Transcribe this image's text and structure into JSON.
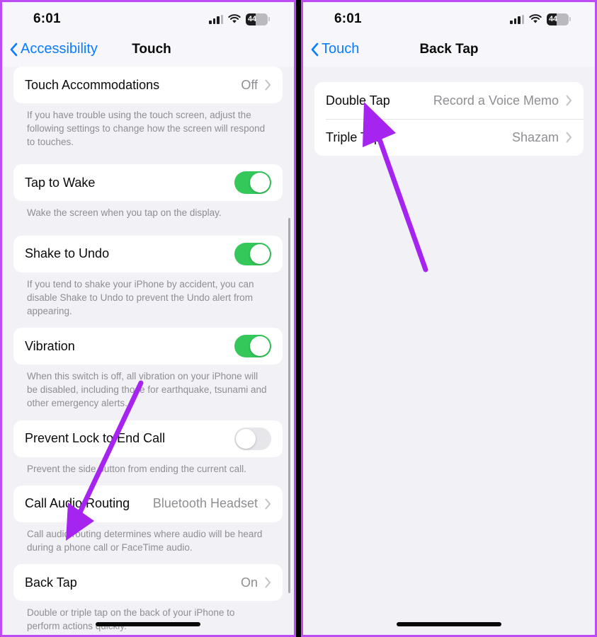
{
  "theme": {
    "accent_blue": "#0a7cff",
    "toggle_on_green": "#34c759",
    "annotation_purple": "#bd4bf7",
    "frame_purple": "#bd4bf7",
    "page_background": "#f2f1f6",
    "card_background": "#ffffff",
    "secondary_text": "#8e8e93"
  },
  "left_phone": {
    "status_bar": {
      "time": "6:01",
      "battery_percent": "44",
      "battery_level": 44,
      "cellular_icon": "cellular-bars-icon",
      "wifi_icon": "wifi-icon",
      "battery_icon": "battery-icon"
    },
    "nav": {
      "back_label": "Accessibility",
      "back_icon": "chevron-left-icon",
      "title": "Touch"
    },
    "sections": [
      {
        "rows": [
          {
            "type": "disclosure",
            "label": "Touch Accommodations",
            "value": "Off"
          }
        ],
        "footnote": "If you have trouble using the touch screen, adjust the following settings to change how the screen will respond to touches."
      },
      {
        "rows": [
          {
            "type": "toggle",
            "label": "Tap to Wake",
            "state": "on"
          }
        ],
        "footnote": "Wake the screen when you tap on the display."
      },
      {
        "rows": [
          {
            "type": "toggle",
            "label": "Shake to Undo",
            "state": "on"
          }
        ],
        "footnote": "If you tend to shake your iPhone by accident, you can disable Shake to Undo to prevent the Undo alert from appearing."
      },
      {
        "rows": [
          {
            "type": "toggle",
            "label": "Vibration",
            "state": "on"
          }
        ],
        "footnote": "When this switch is off, all vibration on your iPhone will be disabled, including those for earthquake, tsunami and other emergency alerts."
      },
      {
        "rows": [
          {
            "type": "toggle",
            "label": "Prevent Lock to End Call",
            "state": "off"
          }
        ],
        "footnote": "Prevent the side button from ending the current call."
      },
      {
        "rows": [
          {
            "type": "disclosure",
            "label": "Call Audio Routing",
            "value": "Bluetooth Headset"
          }
        ],
        "footnote": "Call audio routing determines where audio will be heard during a phone call or FaceTime audio."
      },
      {
        "rows": [
          {
            "type": "disclosure",
            "label": "Back Tap",
            "value": "On"
          }
        ],
        "footnote": "Double or triple tap on the back of your iPhone to perform actions quickly."
      }
    ]
  },
  "right_phone": {
    "status_bar": {
      "time": "6:01",
      "battery_percent": "44",
      "battery_level": 44,
      "cellular_icon": "cellular-bars-icon",
      "wifi_icon": "wifi-icon",
      "battery_icon": "battery-icon"
    },
    "nav": {
      "back_label": "Touch",
      "back_icon": "chevron-left-icon",
      "title": "Back Tap"
    },
    "sections": [
      {
        "rows": [
          {
            "type": "disclosure",
            "label": "Double Tap",
            "value": "Record a Voice Memo"
          },
          {
            "type": "disclosure",
            "label": "Triple Tap",
            "value": "Shazam"
          }
        ],
        "footnote": ""
      }
    ]
  },
  "annotations": [
    {
      "name": "arrow-to-back-tap",
      "target": "Back Tap row in Touch settings"
    },
    {
      "name": "arrow-to-double-tap",
      "target": "Double Tap row in Back Tap settings"
    }
  ]
}
